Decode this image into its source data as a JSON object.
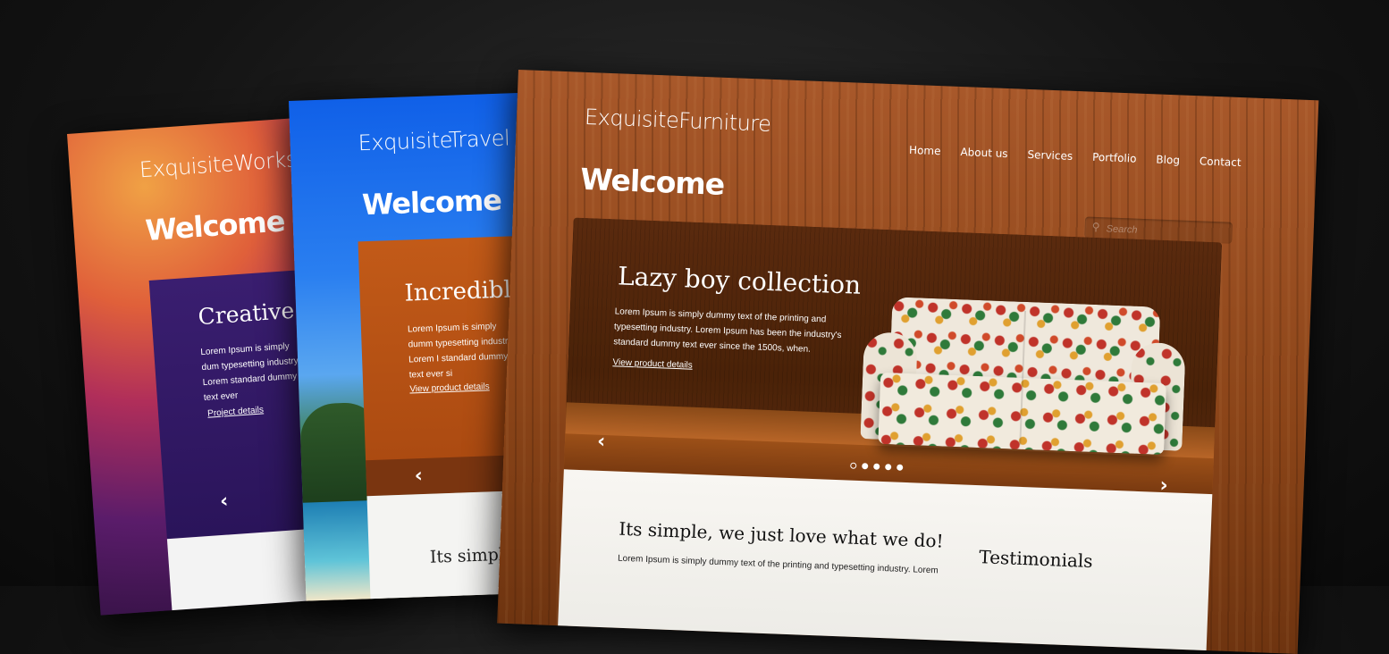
{
  "cards": [
    {
      "id": "works",
      "brand": "ExquisiteWorks",
      "welcome": "Welcome",
      "slide": {
        "title": "Creative J",
        "body": "Lorem Ipsum is simply dum typesetting industry. Lorem standard dummy text ever",
        "link": "Project details"
      },
      "prev_arrow": "‹"
    },
    {
      "id": "travel",
      "brand": "ExquisiteTravel",
      "welcome": "Welcome",
      "slide": {
        "title": "Incredible",
        "body": "Lorem Ipsum is simply dumm typesetting industry. Lorem I standard dummy text ever si",
        "link": "View product details"
      },
      "prev_arrow": "‹",
      "tagline": "Its simple,"
    },
    {
      "id": "furniture",
      "brand": "ExquisiteFurniture",
      "welcome": "Welcome",
      "nav": [
        "Home",
        "About us",
        "Services",
        "Portfolio",
        "Blog",
        "Contact"
      ],
      "search": {
        "placeholder": "Search",
        "icon": "search-icon"
      },
      "slide": {
        "title": "Lazy boy collection",
        "body": "Lorem Ipsum is simply dummy text of the printing and typesetting industry. Lorem Ipsum has been the industry's standard dummy text ever since the 1500s, when.",
        "link": "View product details"
      },
      "prev_arrow": "‹",
      "next_arrow": "›",
      "slide_dots": 5,
      "active_dot": 0,
      "tagline": "Its simple, we just love what we do!",
      "body_text": "Lorem Ipsum is simply dummy text of the printing and typesetting industry. Lorem",
      "testimonials": "Testimonials"
    }
  ]
}
